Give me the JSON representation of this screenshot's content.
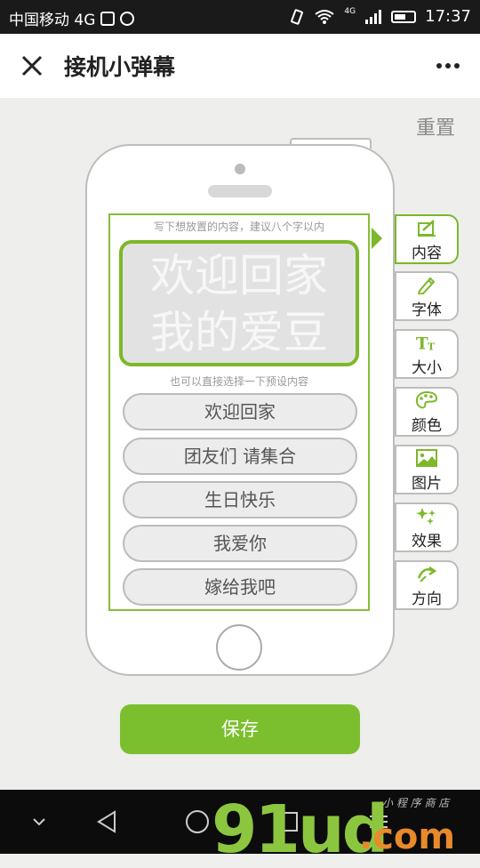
{
  "status_bar": {
    "carrier": "中国移动 4G",
    "time": "17:37",
    "network": "4G"
  },
  "header": {
    "title": "接机小弹幕"
  },
  "toolbar": {
    "reset_label": "重置"
  },
  "editor": {
    "hint": "写下想放置的内容，建议八个字以内",
    "text_line1": "欢迎回家",
    "text_line2": "我的爱豆",
    "preset_hint": "也可以直接选择一下预设内容"
  },
  "presets": [
    "欢迎回家",
    "团友们 请集合",
    "生日快乐",
    "我爱你",
    "嫁给我吧"
  ],
  "side_tabs": [
    {
      "label": "内容",
      "icon": "edit-content-icon",
      "active": true
    },
    {
      "label": "字体",
      "icon": "pencil-icon"
    },
    {
      "label": "大小",
      "icon": "text-size-icon"
    },
    {
      "label": "颜色",
      "icon": "palette-icon"
    },
    {
      "label": "图片",
      "icon": "image-icon"
    },
    {
      "label": "效果",
      "icon": "sparkle-icon"
    },
    {
      "label": "方向",
      "icon": "direction-icon"
    }
  ],
  "save_label": "保存",
  "watermark": {
    "main": "91ud",
    "suffix": ".com",
    "tagline": "小 程 序 商 店"
  },
  "colors": {
    "accent": "#7cbf2e",
    "border": "#bdbdbd"
  }
}
